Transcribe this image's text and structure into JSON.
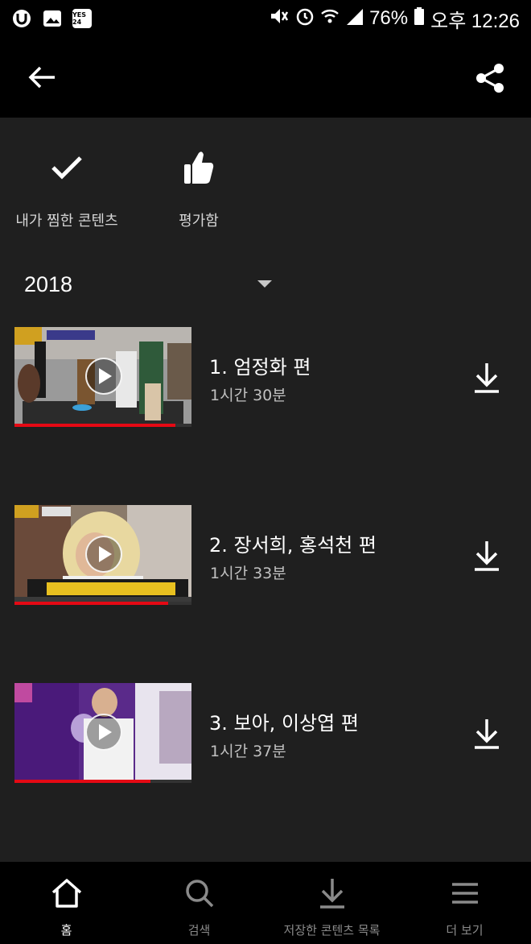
{
  "status": {
    "battery": "76%",
    "time": "오후 12:26",
    "yes24_label": "YES 24"
  },
  "actions": [
    {
      "label": "내가 찜한 콘텐츠",
      "icon": "check-icon"
    },
    {
      "label": "평가함",
      "icon": "thumbs-up-icon"
    }
  ],
  "season": {
    "selected": "2018"
  },
  "episodes": [
    {
      "title": "1. 엄정화 편",
      "duration": "1시간 30분",
      "progress": 0.91
    },
    {
      "title": "2. 장서희, 홍석천 편",
      "duration": "1시간 33분",
      "progress": 0.87
    },
    {
      "title": "3. 보아, 이상엽 편",
      "duration": "1시간 37분",
      "progress": 0.77
    }
  ],
  "nav": [
    {
      "label": "홈",
      "icon": "home-icon",
      "active": true
    },
    {
      "label": "검색",
      "icon": "search-icon",
      "active": false
    },
    {
      "label": "저장한 콘텐츠 목록",
      "icon": "download-icon",
      "active": false
    },
    {
      "label": "더 보기",
      "icon": "menu-icon",
      "active": false
    }
  ],
  "colors": {
    "accent": "#e50914",
    "background": "#1f1f1f",
    "bar": "#000000"
  }
}
